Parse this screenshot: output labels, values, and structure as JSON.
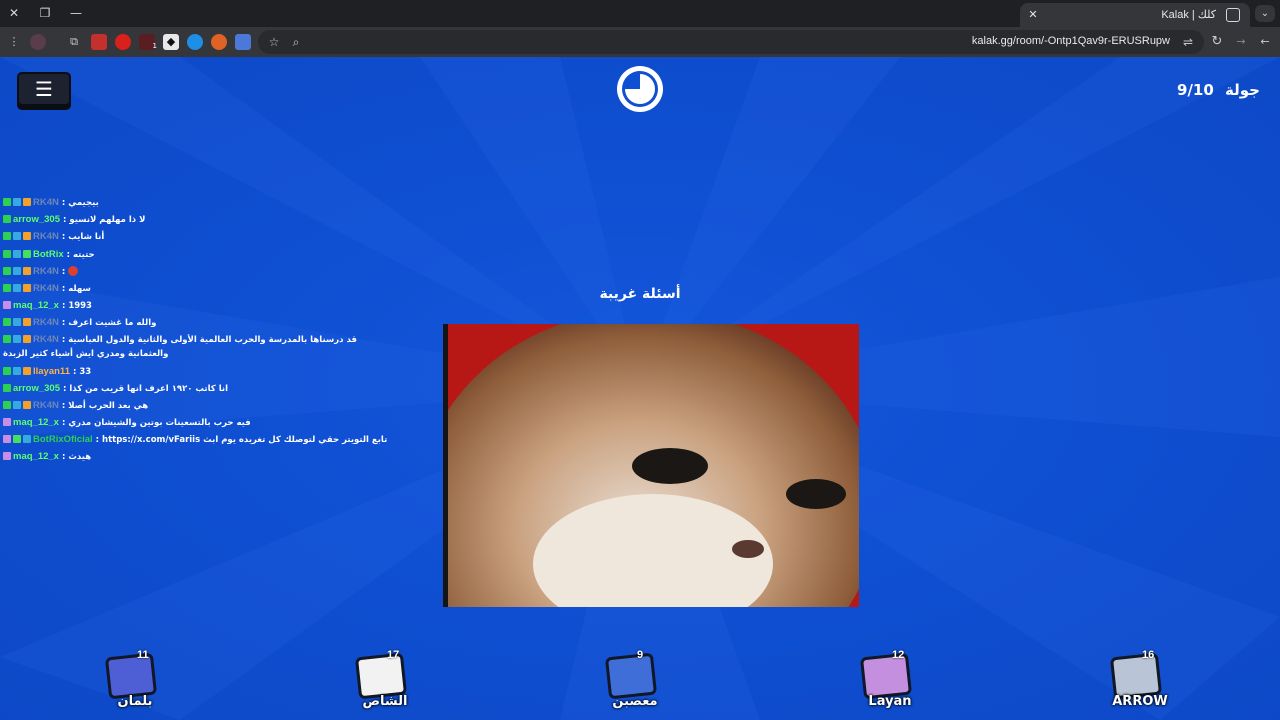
{
  "browser": {
    "tab_title": "Kalak | كلك",
    "url": "kalak.gg/room/-Ontp1Qav9r-ERUSRupw",
    "extension_badge": "1"
  },
  "game": {
    "round_label": "جولة",
    "round_value": "9/10",
    "question_title": "أسئلة غريبة",
    "timer_fraction_remaining": 0.75
  },
  "chat": [
    {
      "badges": [
        "k",
        "s",
        "o"
      ],
      "user": "RK4N",
      "user_color": "#6f86b8",
      "text": "بيجيمي"
    },
    {
      "badges": [
        "k"
      ],
      "user": "arrow_305",
      "user_color": "#5dff6e",
      "text": "لا ذا مهلهم لانسيو"
    },
    {
      "badges": [
        "k",
        "s",
        "o"
      ],
      "user": "RK4N",
      "user_color": "#6f86b8",
      "text": "أنا شايب"
    },
    {
      "badges": [
        "k",
        "s",
        "g"
      ],
      "user": "BotRix",
      "user_color": "#5dff6e",
      "text": "حتيته"
    },
    {
      "badges": [
        "k",
        "s",
        "o"
      ],
      "user": "RK4N",
      "user_color": "#6f86b8",
      "text": "",
      "emote": true
    },
    {
      "badges": [
        "k",
        "s",
        "o"
      ],
      "user": "RK4N",
      "user_color": "#6f86b8",
      "text": "سهله"
    },
    {
      "badges": [
        "p"
      ],
      "user": "maq_12_x",
      "user_color": "#5dff6e",
      "text": "1993"
    },
    {
      "badges": [
        "k",
        "s",
        "o"
      ],
      "user": "RK4N",
      "user_color": "#6f86b8",
      "text": "والله ما غشيت اعرف"
    },
    {
      "badges": [
        "k",
        "s",
        "o"
      ],
      "user": "RK4N",
      "user_color": "#6f86b8",
      "text": "قد درسناها بالمدرسة والحرب العالمية الأولى والثانية والدول العباسية والعثمانية ومدري ايش أشياء كثير الزبدة",
      "tall": true
    },
    {
      "badges": [
        "k",
        "s",
        "o"
      ],
      "user": "llayan11",
      "user_color": "#ffb347",
      "text": "33"
    },
    {
      "badges": [
        "k"
      ],
      "user": "arrow_305",
      "user_color": "#5dff6e",
      "text": "انا كاتب ١٩٢٠ اعرف انها قريب من كذا"
    },
    {
      "badges": [
        "k",
        "s",
        "o"
      ],
      "user": "RK4N",
      "user_color": "#6f86b8",
      "text": "هي بعد الحرب أصلا"
    },
    {
      "badges": [
        "p"
      ],
      "user": "maq_12_x",
      "user_color": "#5dff6e",
      "text": "فيه حرب بالتسعينات بوتين والشيشان مدري"
    },
    {
      "badges": [
        "p",
        "g",
        "s"
      ],
      "user": "BotRixOficial",
      "user_color": "#2bd14f",
      "text": "https://x.com/vFariis تابع التويتر حقي لتوصلك كل تغريده يوم ابث"
    },
    {
      "badges": [
        "p"
      ],
      "user": "maq_12_x",
      "user_color": "#5dff6e",
      "text": "هيدث"
    }
  ],
  "players": [
    {
      "name": "بلمان",
      "score": "11",
      "color": "#4e5fd6"
    },
    {
      "name": "الشاص",
      "score": "17",
      "color": "#f2f2f2"
    },
    {
      "name": "معصبن",
      "score": "9",
      "color": "#3f6ed8"
    },
    {
      "name": "Layan",
      "score": "12",
      "color": "#c58fe0"
    },
    {
      "name": "ARROW",
      "score": "16",
      "color": "#b9c4d6"
    }
  ],
  "colors": {
    "page_bg": "#0f4fd2",
    "chrome_dark": "#1f2023",
    "toolbar": "#35363a"
  },
  "icons": {
    "menu": "hamburger-icon",
    "timer": "pie-timer-icon"
  }
}
